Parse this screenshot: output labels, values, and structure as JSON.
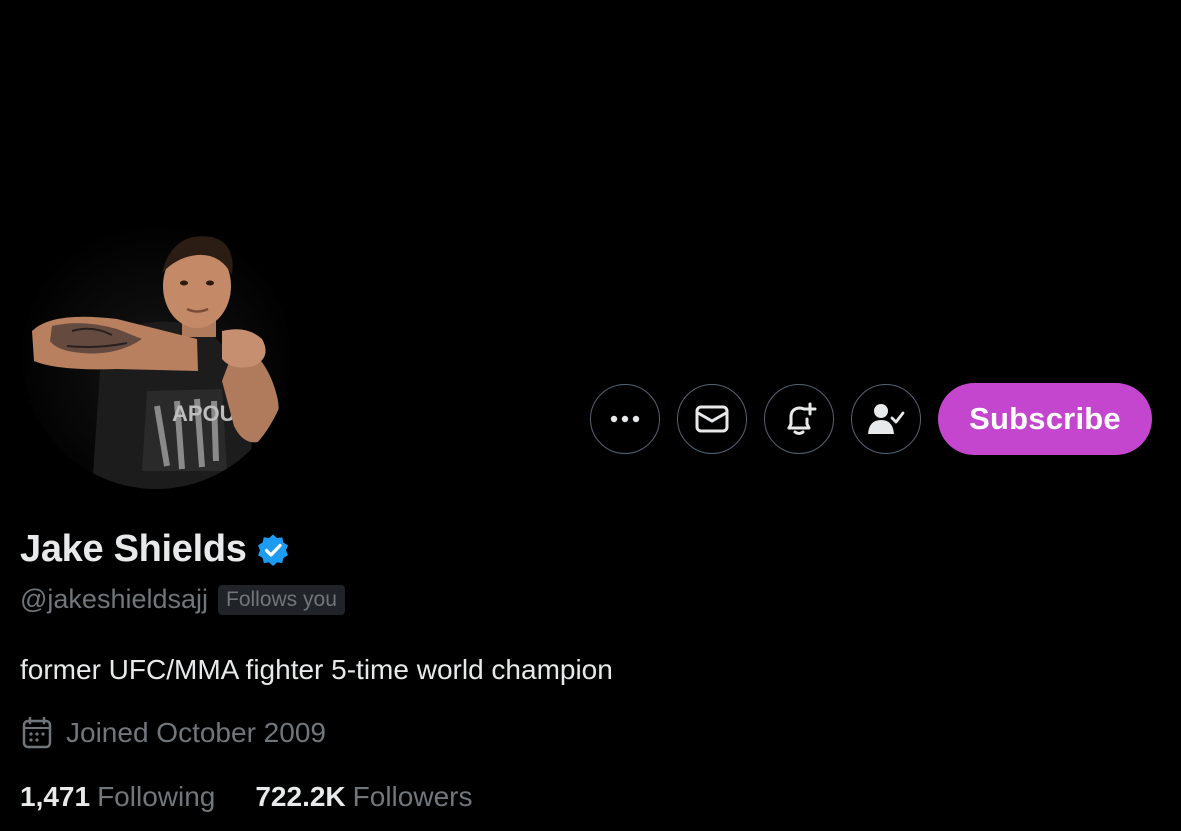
{
  "profile": {
    "display_name": "Jake Shields",
    "handle": "@jakeshieldsajj",
    "follows_you_badge": "Follows you",
    "bio": "former UFC/MMA fighter 5-time world champion",
    "joined": "Joined October 2009",
    "verified": true
  },
  "stats": {
    "following_count": "1,471",
    "following_label": "Following",
    "followers_count": "722.2K",
    "followers_label": "Followers"
  },
  "actions": {
    "more_icon": "more-horizontal-icon",
    "message_icon": "envelope-icon",
    "notify_icon": "bell-plus-icon",
    "following_icon": "person-check-icon",
    "subscribe_label": "Subscribe"
  },
  "colors": {
    "background": "#000000",
    "subscribe": "#c446cf",
    "verified": "#1d9bf0",
    "secondary_text": "#71767b"
  }
}
